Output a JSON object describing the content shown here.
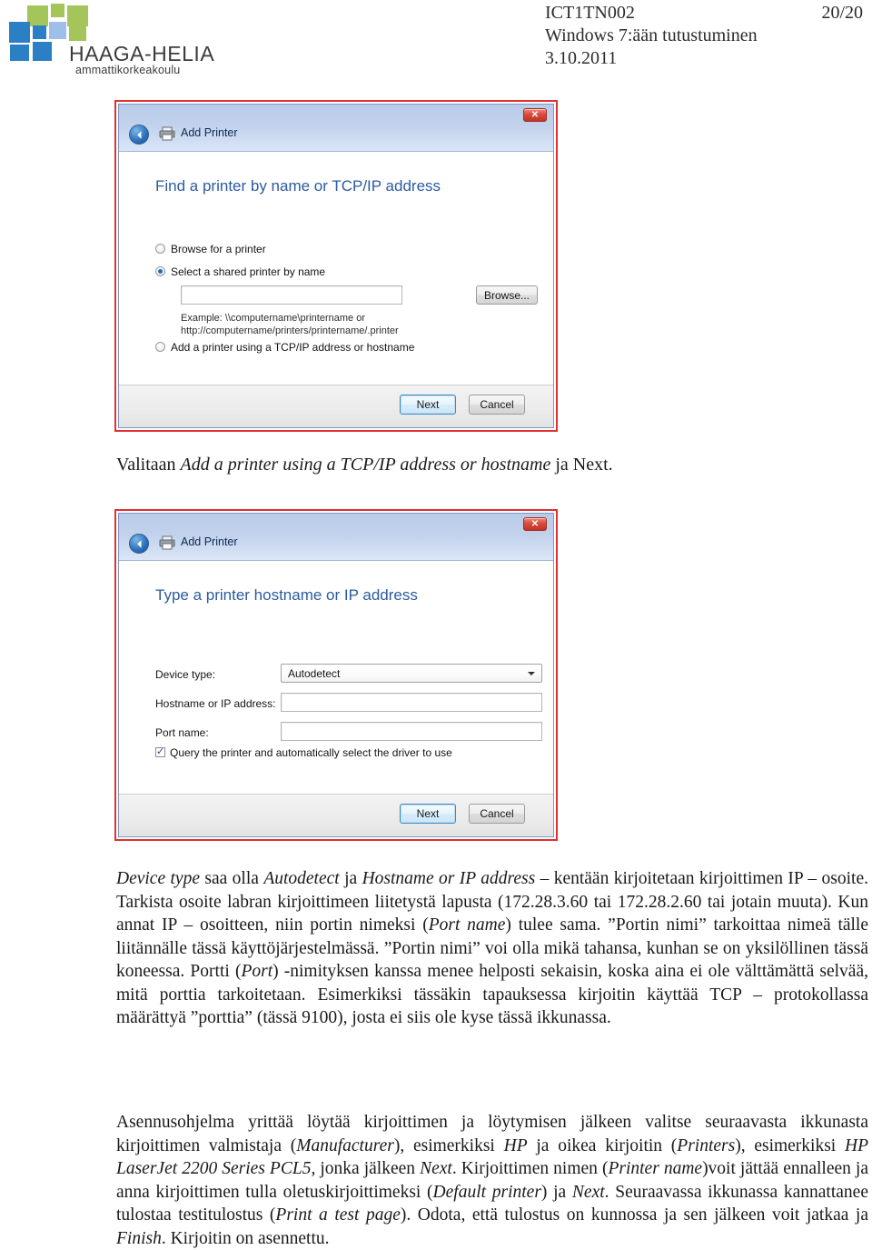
{
  "header": {
    "logo": {
      "name": "HAAGA-HELIA",
      "subtitle": "ammattikorkeakoulu"
    },
    "course_code": "ICT1TN002",
    "page_number": "20/20",
    "doc_title": "Windows 7:ään tutustuminen",
    "date": "3.10.2011"
  },
  "dialog1": {
    "title": "Add Printer",
    "heading": "Find a printer by name or TCP/IP address",
    "options": [
      {
        "label": "Browse for a printer",
        "checked": false
      },
      {
        "label": "Select a shared printer by name",
        "checked": true
      },
      {
        "label": "Add a printer using a TCP/IP address or hostname",
        "checked": false
      }
    ],
    "shared_name_value": "",
    "browse_label": "Browse...",
    "example_text": "Example: \\\\computername\\printername or\nhttp://computername/printers/printername/.printer",
    "next_label": "Next",
    "cancel_label": "Cancel",
    "close_label": "✕"
  },
  "dialog2": {
    "title": "Add Printer",
    "heading": "Type a printer hostname or IP address",
    "fields": [
      {
        "label": "Device type:",
        "value": "Autodetect",
        "type": "combo"
      },
      {
        "label": "Hostname or IP address:",
        "value": "",
        "type": "text"
      },
      {
        "label": "Port name:",
        "value": "",
        "type": "text"
      }
    ],
    "query_checkbox": {
      "label": "Query the printer and automatically select the driver to use",
      "checked": true
    },
    "next_label": "Next",
    "cancel_label": "Cancel",
    "close_label": "✕"
  },
  "caption": {
    "pre": "Valitaan ",
    "em": "Add a printer using a TCP/IP address or hostname",
    "post": " ja Next."
  },
  "paragraphs": {
    "p1_html": "<em>Device type</em> saa olla <em>Autodetect</em> ja <em>Hostname or IP address</em> &#8211; kentään kirjoitetaan kirjoittimen IP &#8211; osoite. Tarkista osoite labran kirjoittimeen liitetystä lapusta (172.28.3.60 tai 172.28.2.60 tai jotain muuta). Kun annat IP &#8211; osoitteen, niin portin nimeksi (<em>Port name</em>) tulee sama. ”Portin nimi” tarkoittaa nimeä tälle liitännälle tässä käyttöjärjestelmässä. ”Portin nimi” voi olla mikä tahansa, kunhan se on yksilöllinen tässä koneessa. Portti (<em>Port</em>) -nimityksen kanssa menee helposti sekaisin, koska aina ei ole välttämättä selvää, mitä porttia tarkoitetaan. Esimerkiksi tässäkin tapauksessa kirjoitin käyttää TCP &#8211; protokollassa määrättyä ”porttia” (tässä 9100), josta ei siis ole kyse tässä ikkunassa.",
    "p2_html": "Asennusohjelma yrittää löytää kirjoittimen ja löytymisen jälkeen valitse seuraavasta ikkunasta kirjoittimen valmistaja (<em>Manufacturer</em>), esimerkiksi <em>HP</em> ja oikea kirjoitin (<em>Printers</em>), esimerkiksi <em>HP LaserJet 2200 Series PCL5</em>, jonka jälkeen <em>Next</em>. Kirjoittimen nimen (<em>Printer name</em>)voit jättää ennalleen ja anna kirjoittimen tulla oletuskirjoittimeksi (<em>Default printer</em>) ja <em>Next</em>. Seuraavassa ikkunassa kannattanee tulostaa testitulostus (<em>Print a test page</em>). Odota, että tulostus on kunnossa ja sen jälkeen voit jatkaa ja <em>Finish</em>. Kirjoitin on asennettu."
  },
  "colors": {
    "dialog_border": "#e03030",
    "titlebar": "#c2d2ec",
    "heading_blue": "#2b5ba1",
    "logo_green": "#a4c55a",
    "logo_blue_dark": "#2b7fc4",
    "logo_blue_light": "#9ec0e8",
    "close_red": "#c03526"
  }
}
